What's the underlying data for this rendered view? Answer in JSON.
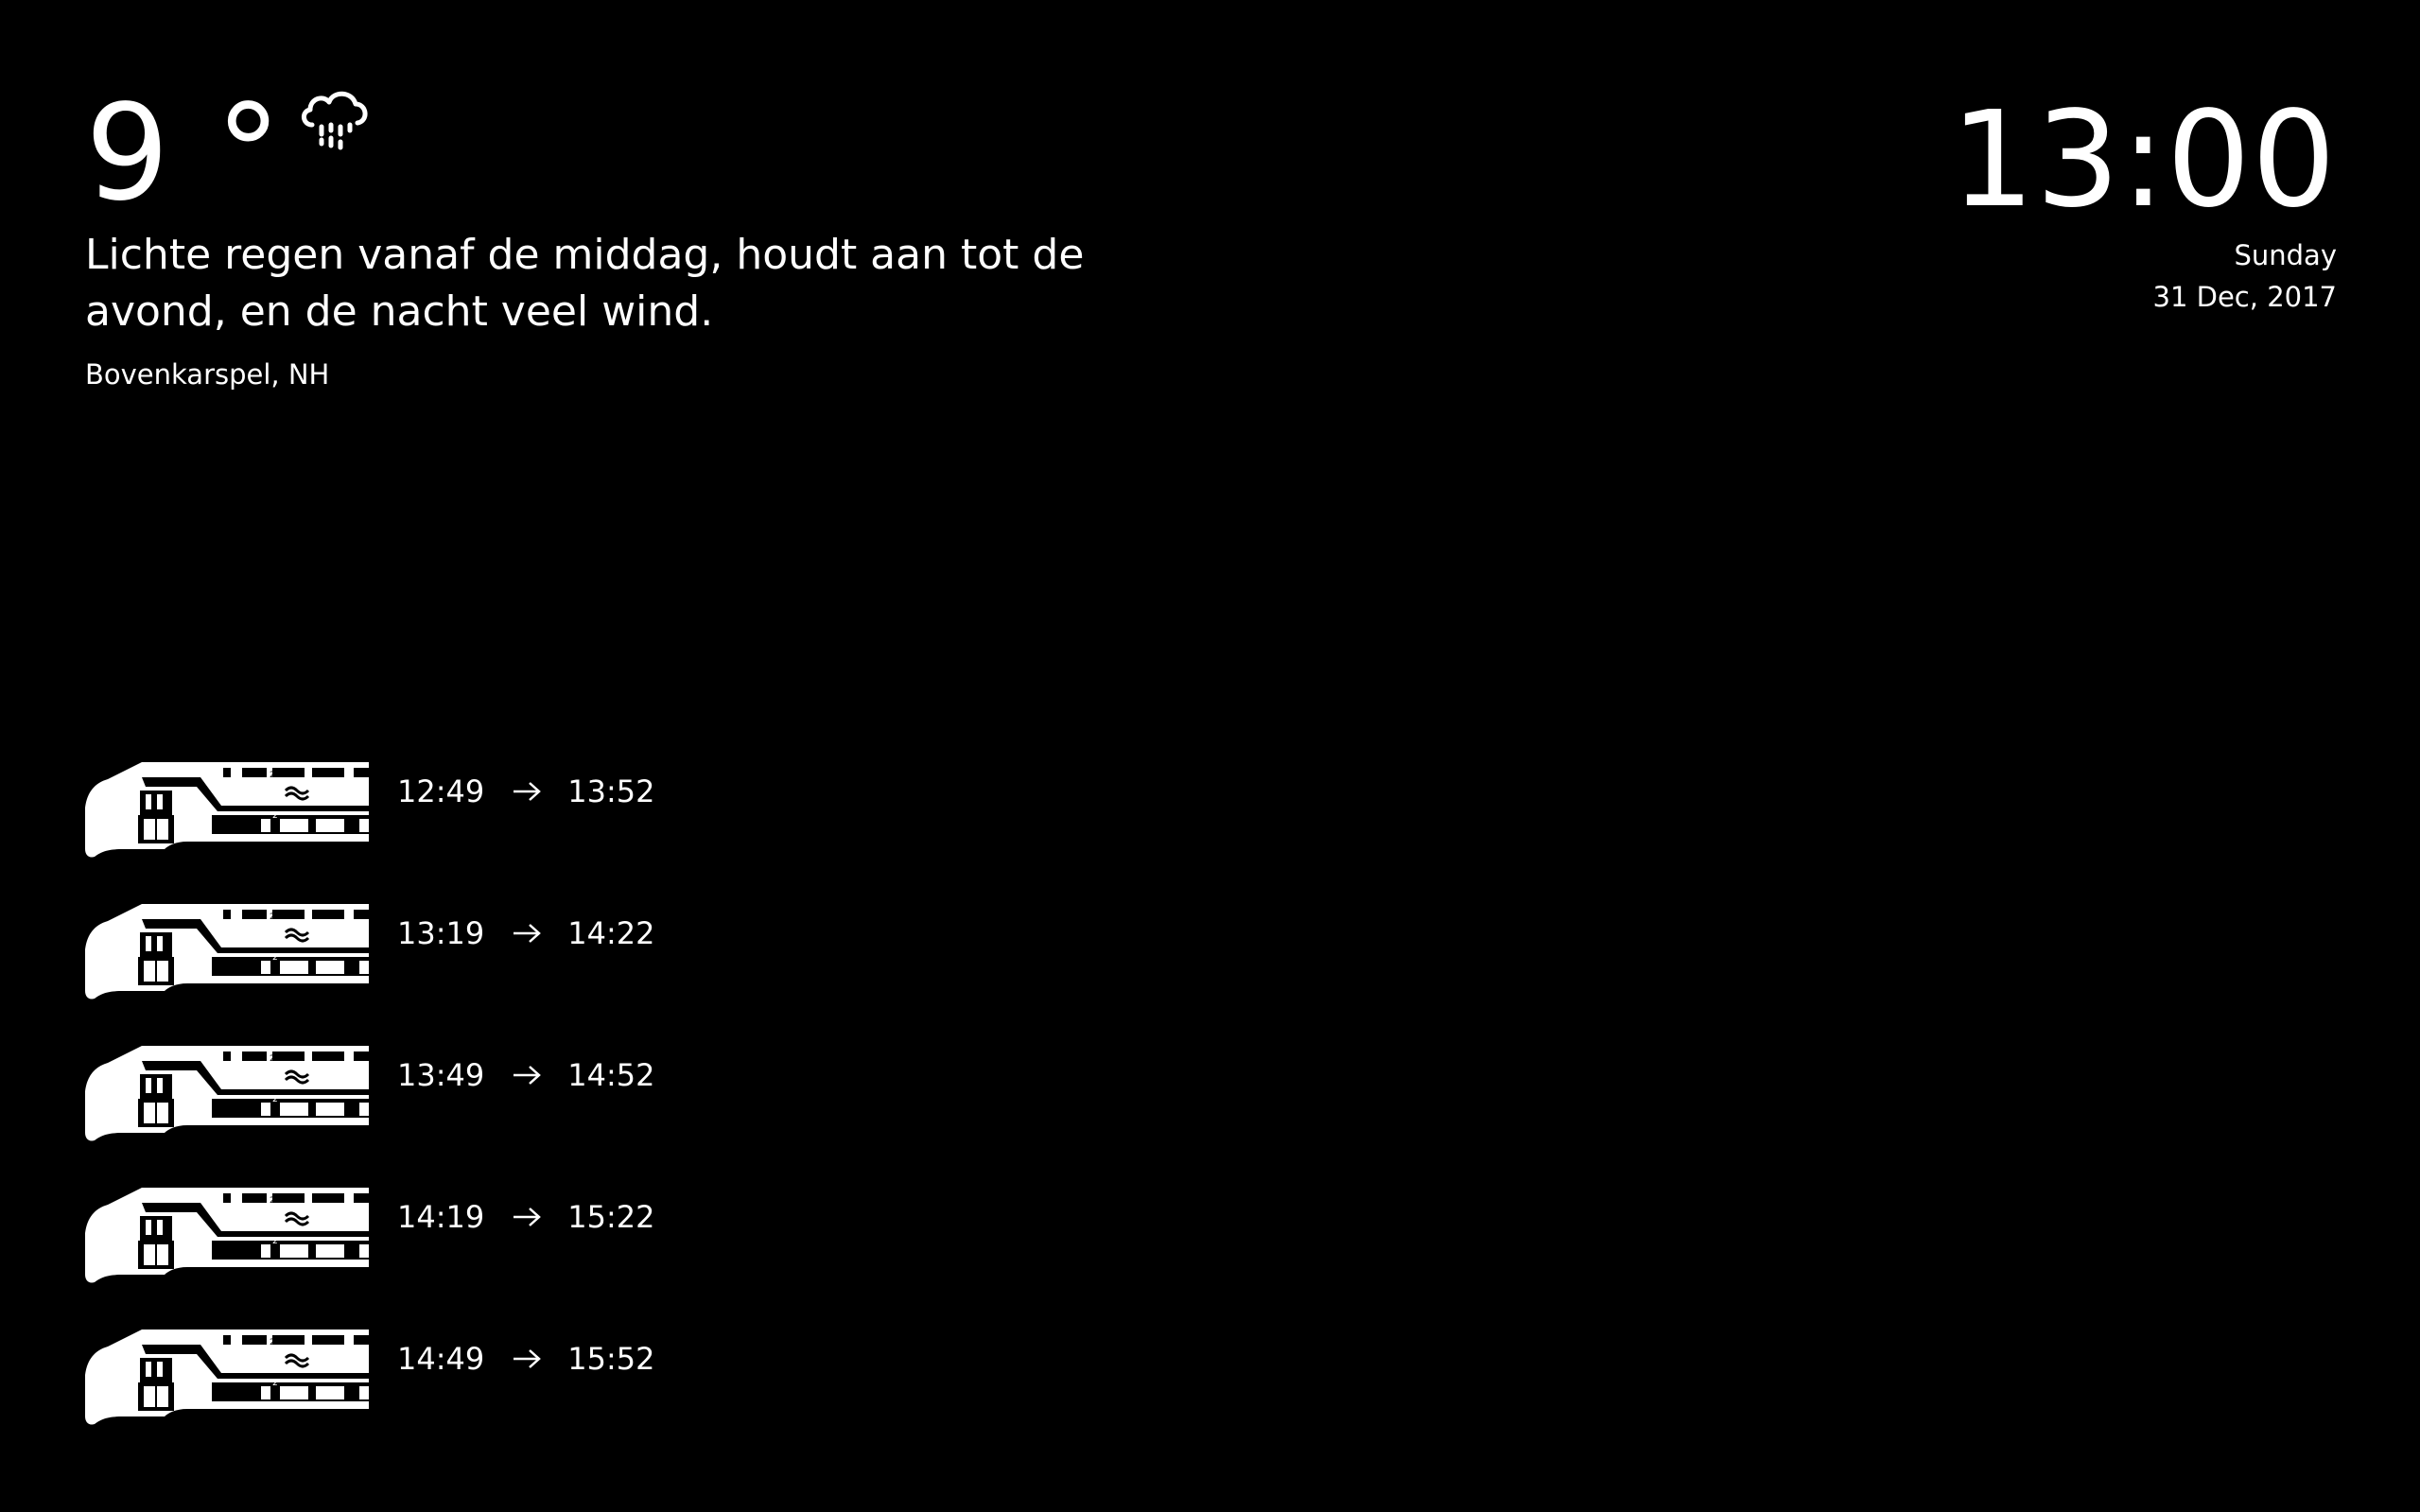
{
  "weather": {
    "temperature": "9 °",
    "icon": "rain-cloud-icon",
    "summary": "Lichte regen vanaf de middag, houdt aan tot de avond, en de nacht veel wind.",
    "location": "Bovenkarspel, NH"
  },
  "clock": {
    "time": "13:00",
    "day": "Sunday",
    "date": "31 Dec, 2017"
  },
  "trains": [
    {
      "departure": "12:49",
      "arrival": "13:52",
      "icon": "train-icon"
    },
    {
      "departure": "13:19",
      "arrival": "14:22",
      "icon": "train-icon"
    },
    {
      "departure": "13:49",
      "arrival": "14:52",
      "icon": "train-icon"
    },
    {
      "departure": "14:19",
      "arrival": "15:22",
      "icon": "train-icon"
    },
    {
      "departure": "14:49",
      "arrival": "15:52",
      "icon": "train-icon"
    }
  ],
  "colors": {
    "background": "#000000",
    "foreground": "#ffffff"
  }
}
